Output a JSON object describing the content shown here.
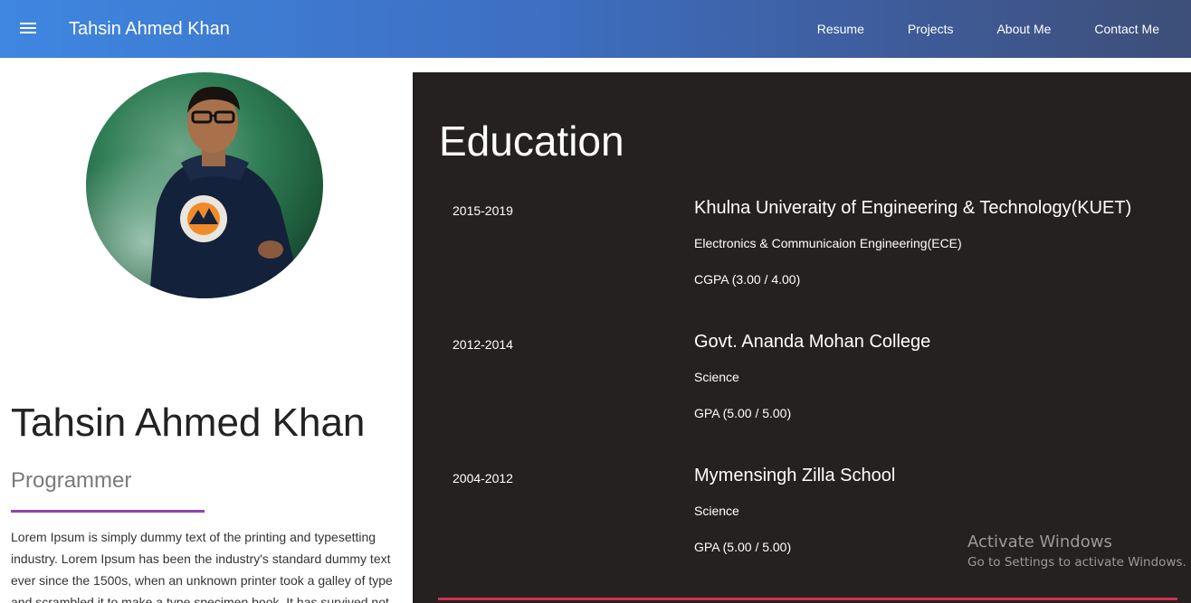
{
  "header": {
    "brand": "Tahsin Ahmed Khan",
    "nav": [
      "Resume",
      "Projects",
      "About Me",
      "Contact Me"
    ]
  },
  "profile": {
    "name": "Tahsin Ahmed Khan",
    "role": "Programmer",
    "bio": "Lorem Ipsum is simply dummy text of the printing and typesetting industry. Lorem Ipsum has been the industry's standard dummy text ever since the 1500s, when an unknown printer took a galley of type and scrambled it to make a type specimen book. It has survived not"
  },
  "education": {
    "title": "Education",
    "items": [
      {
        "years": "2015-2019",
        "institution": "Khulna Univeraity of Engineering & Technology(KUET)",
        "department": "Electronics & Communicaion Engineering(ECE)",
        "grade": "CGPA (3.00 / 4.00)"
      },
      {
        "years": "2012-2014",
        "institution": "Govt. Ananda Mohan College",
        "department": "Science",
        "grade": "GPA (5.00 / 5.00)"
      },
      {
        "years": "2004-2012",
        "institution": "Mymensingh Zilla School",
        "department": "Science",
        "grade": "GPA (5.00 / 5.00)"
      }
    ]
  },
  "watermark": {
    "title": "Activate Windows",
    "subtitle": "Go to Settings to activate Windows."
  },
  "colors": {
    "header_gradient_start": "#3f86e0",
    "header_gradient_end": "#3d4f78",
    "edu_background": "#252120",
    "role_underline": "#8e44ad",
    "edu_divider": "#d5304a"
  }
}
